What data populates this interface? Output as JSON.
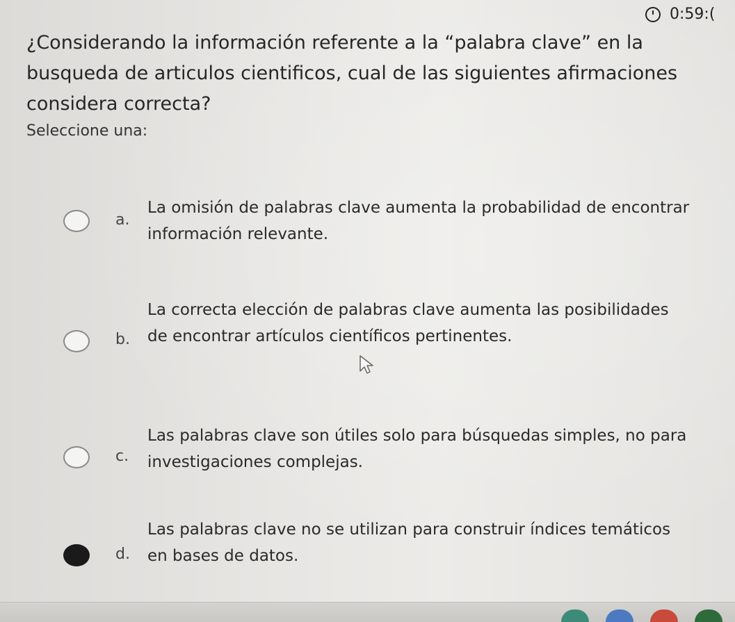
{
  "timer": {
    "value": "0:59:(",
    "icon": "clock-icon"
  },
  "question": {
    "text": "¿Considerando la información referente a la “palabra clave” en la busqueda de articulos cientificos, cual de las siguientes afirmaciones considera correcta?"
  },
  "prompt": "Seleccione una:",
  "options": [
    {
      "letter": "a.",
      "text": "La omisión de palabras clave aumenta la probabilidad de encontrar información relevante.",
      "selected": false
    },
    {
      "letter": "b.",
      "text": "La correcta elección de palabras clave aumenta las posibilidades de encontrar artículos científicos pertinentes.",
      "selected": false
    },
    {
      "letter": "c.",
      "text": "Las palabras clave son útiles solo para búsquedas simples, no para investigaciones complejas.",
      "selected": false
    },
    {
      "letter": "d.",
      "text": "Las palabras clave no se utilizan para construir índices temáticos en bases de datos.",
      "selected": true
    }
  ],
  "colors": {
    "radio_selected": "#1a1a1a",
    "radio_border": "#8a8a8a",
    "background": "#e6e5e2"
  }
}
